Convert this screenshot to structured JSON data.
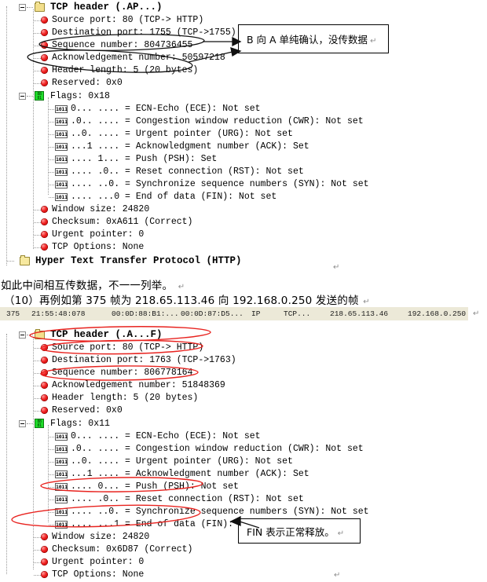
{
  "colors": {
    "ellipse_black": "#111111",
    "ellipse_red": "#e8231f",
    "packet_row_bg": "#ece9d8",
    "bullet_red": "#f02020",
    "flags_green": "#1fdd2a",
    "folder_yellow": "#f7e9a0"
  },
  "block1": {
    "root": "TCP header (.AP...)",
    "rows": [
      "Source port: 80 (TCP-> HTTP)",
      "Destination port: 1755 (TCP->1755)",
      "Sequence number: 804736455",
      "Acknowledgement number: 50597218",
      "Header length: 5 (20 bytes)",
      "Reserved: 0x0"
    ],
    "flags_label": "Flags: 0x18",
    "flag_rows": [
      {
        "bits": "1011",
        "text": "0... .... = ECN-Echo (ECE): Not set"
      },
      {
        "bits": "1011",
        "text": ".0.. .... = Congestion window reduction (CWR): Not set"
      },
      {
        "bits": "1011",
        "text": "..0. .... = Urgent pointer (URG): Not set"
      },
      {
        "bits": "1011",
        "text": "...1 .... = Acknowledgment number (ACK): Set"
      },
      {
        "bits": "1011",
        "text": ".... 1... = Push (PSH): Set"
      },
      {
        "bits": "1011",
        "text": ".... .0.. = Reset connection (RST): Not set"
      },
      {
        "bits": "1011",
        "text": ".... ..0. = Synchronize sequence numbers (SYN): Not set"
      },
      {
        "bits": "1011",
        "text": ".... ...0 = End of data (FIN): Not set"
      }
    ],
    "tail_rows": [
      "Window size: 24820",
      "Checksum: 0xA611 (Correct)",
      "Urgent pointer: 0",
      "TCP Options: None"
    ],
    "http_row": "Hyper Text Transfer Protocol (HTTP)",
    "callout": "B 向 A 单纯确认，没传数据"
  },
  "prose": {
    "line1": "如此中间相互传数据，不一一列举。",
    "line2": "（10）再例如第 375 帧为 218.65.113.46 向 192.168.0.250 发送的帧",
    "pilcrow": "↵"
  },
  "packet": {
    "no": "375",
    "time": "21:55:48:078",
    "src_mac": "00:0D:88:B1:...",
    "dst_mac": "00:0D:87:D5...",
    "proto1": "IP",
    "proto2": "TCP...",
    "src_ip": "218.65.113.46",
    "dst_ip": "192.168.0.250"
  },
  "block2": {
    "root": "TCP header (.A...F)",
    "rows": [
      "Source port: 80 (TCP-> HTTP)",
      "Destination port: 1763 (TCP->1763)",
      "Sequence number: 806778164",
      "Acknowledgement number: 51848369",
      "Header length: 5 (20 bytes)",
      "Reserved: 0x0"
    ],
    "flags_label": "Flags: 0x11",
    "flag_rows": [
      {
        "bits": "1011",
        "text": "0... .... = ECN-Echo (ECE): Not set"
      },
      {
        "bits": "1011",
        "text": ".0.. .... = Congestion window reduction (CWR): Not set"
      },
      {
        "bits": "1011",
        "text": "..0. .... = Urgent pointer (URG): Not set"
      },
      {
        "bits": "1011",
        "text": "...1 .... = Acknowledgment number (ACK): Set"
      },
      {
        "bits": "1011",
        "text": ".... 0... = Push (PSH): Not set"
      },
      {
        "bits": "1011",
        "text": ".... .0.. = Reset connection (RST): Not set"
      },
      {
        "bits": "1011",
        "text": ".... ..0. = Synchronize sequence numbers (SYN): Not set"
      },
      {
        "bits": "1011",
        "text": ".... ...1 = End of data (FIN): Set"
      }
    ],
    "tail_rows": [
      "Window size: 24820",
      "Checksum: 0x6D87 (Correct)",
      "Urgent pointer: 0",
      "TCP Options: None"
    ],
    "callout": "FIN 表示正常释放。"
  }
}
